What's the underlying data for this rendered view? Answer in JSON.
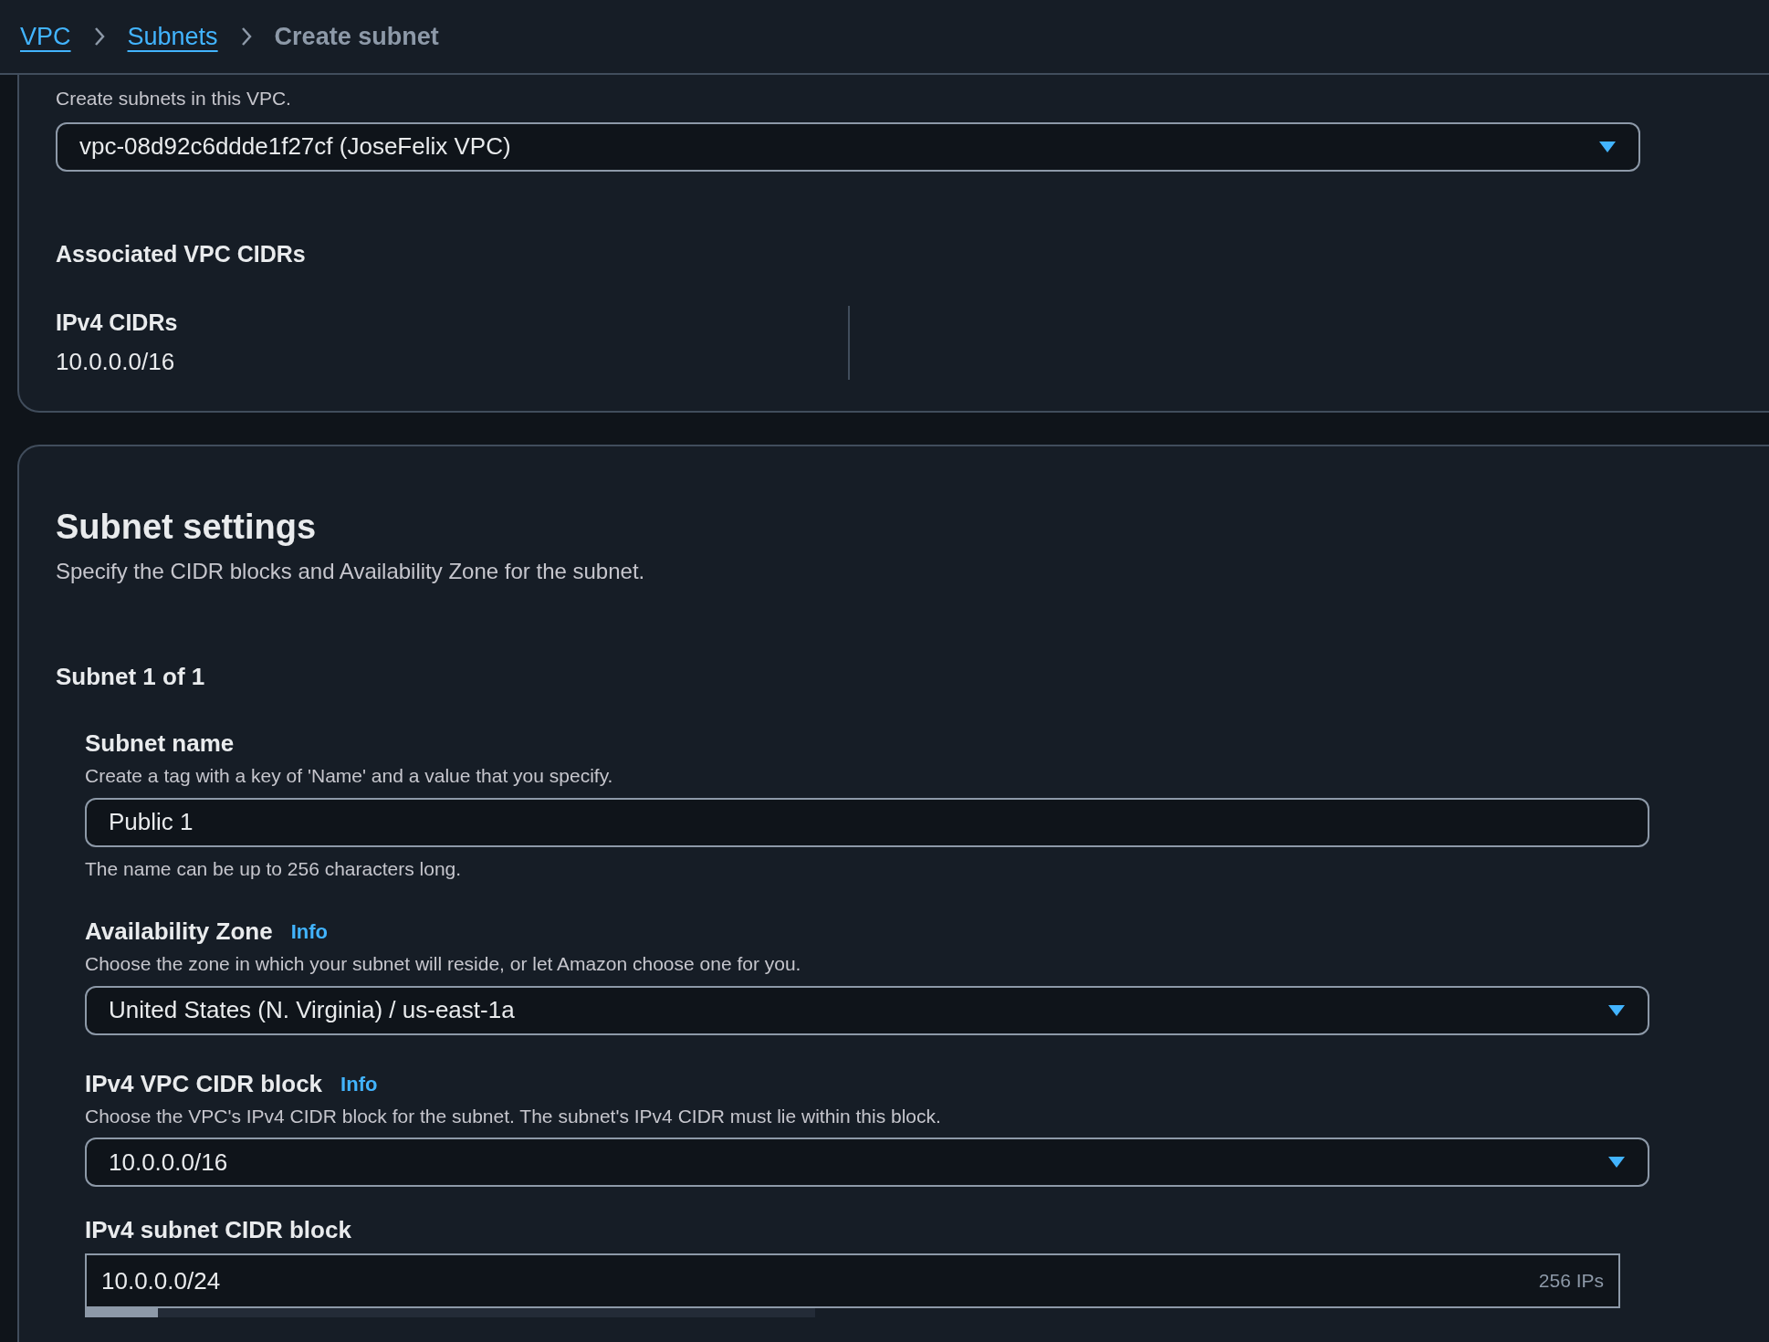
{
  "breadcrumbs": [
    {
      "label": "VPC",
      "kind": "link"
    },
    {
      "label": "Subnets",
      "kind": "link"
    },
    {
      "label": "Create subnet",
      "kind": "current"
    }
  ],
  "vpc_section": {
    "description": "Create subnets in this VPC.",
    "vpc_select": {
      "value": "vpc-08d92c6ddde1f27cf (JoseFelix VPC)"
    },
    "associated_heading": "Associated VPC CIDRs",
    "ipv4_label": "IPv4 CIDRs",
    "ipv4_value": "10.0.0.0/16"
  },
  "subnet_settings": {
    "title": "Subnet settings",
    "description": "Specify the CIDR blocks and Availability Zone for the subnet.",
    "subnet_counter": "Subnet 1 of 1",
    "fields": [
      {
        "kind": "input",
        "label": "Subnet name",
        "description": "Create a tag with a key of 'Name' and a value that you specify.",
        "value": "Public 1",
        "hint": "The name can be up to 256 characters long."
      },
      {
        "kind": "select",
        "label": "Availability Zone",
        "info": "Info",
        "description": "Choose the zone in which your subnet will reside, or let Amazon choose one for you.",
        "value": "United States (N. Virginia) / us-east-1a"
      },
      {
        "kind": "select",
        "label": "IPv4 VPC CIDR block",
        "info": "Info",
        "description": "Choose the VPC's IPv4 CIDR block for the subnet. The subnet's IPv4 CIDR must lie within this block.",
        "value": "10.0.0.0/16"
      },
      {
        "kind": "cidr",
        "label": "IPv4 subnet CIDR block",
        "value": "10.0.0.0/24",
        "suffix": "256 IPs",
        "level": 0
      }
    ]
  }
}
